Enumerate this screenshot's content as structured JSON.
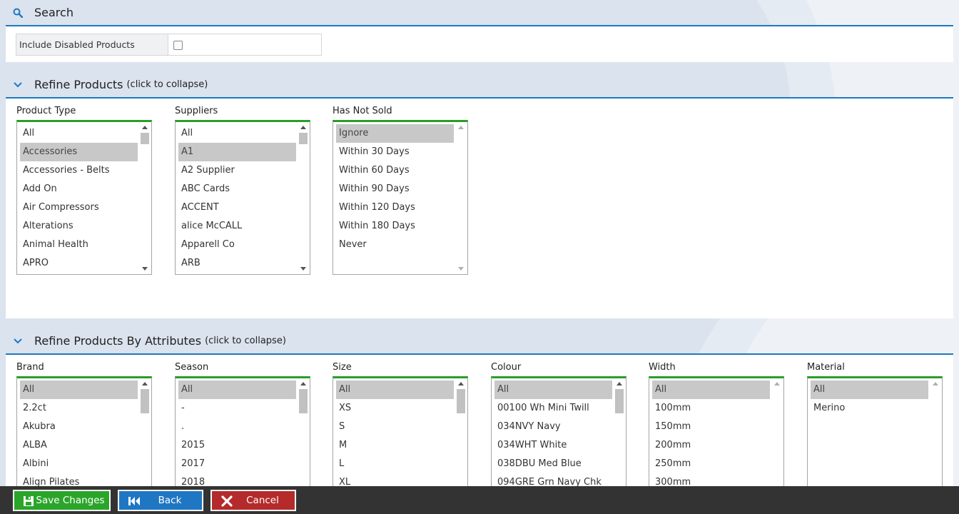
{
  "search": {
    "title": "Search"
  },
  "include_disabled": {
    "label": "Include Disabled Products",
    "checked": false
  },
  "refine_products": {
    "title": "Refine Products",
    "hint": "(click to collapse)",
    "lists": [
      {
        "label": "Product Type",
        "items": [
          "All",
          "Accessories",
          "Accessories - Belts",
          "Add On",
          "Air Compressors",
          "Alterations",
          "Animal Health",
          "APRO"
        ],
        "selected": 1,
        "scrollbar": true
      },
      {
        "label": "Suppliers",
        "items": [
          "All",
          "A1",
          "A2 Supplier",
          "ABC Cards",
          "ACCENT",
          "alice McCALL",
          "Apparell Co",
          "ARB"
        ],
        "selected": 1,
        "scrollbar": true
      },
      {
        "label": "Has Not Sold",
        "items": [
          "Ignore",
          "Within 30 Days",
          "Within 60 Days",
          "Within 90 Days",
          "Within 120 Days",
          "Within 180 Days",
          "Never"
        ],
        "selected": 0,
        "scrollbar": false
      }
    ]
  },
  "refine_attributes": {
    "title": "Refine Products By Attributes",
    "hint": "(click to collapse)",
    "lists": [
      {
        "label": "Brand",
        "items": [
          "All",
          "2.2ct",
          "Akubra",
          "ALBA",
          "Albini",
          "Align Pilates"
        ],
        "selected": 0,
        "scrollbar": true
      },
      {
        "label": "Season",
        "items": [
          "All",
          "-",
          ".",
          "2015",
          "2017",
          "2018"
        ],
        "selected": 0,
        "scrollbar": true
      },
      {
        "label": "Size",
        "items": [
          "All",
          "XS",
          "S",
          "M",
          "L",
          "XL"
        ],
        "selected": 0,
        "scrollbar": true
      },
      {
        "label": "Colour",
        "items": [
          "All",
          "00100 Wh Mini Twill",
          "034NVY Navy",
          "034WHT White",
          "038DBU Med Blue",
          "094GRE Grn Navy Chk"
        ],
        "selected": 0,
        "scrollbar": true
      },
      {
        "label": "Width",
        "items": [
          "All",
          "100mm",
          "150mm",
          "200mm",
          "250mm",
          "300mm"
        ],
        "selected": 0,
        "scrollbar": false
      },
      {
        "label": "Material",
        "items": [
          "All",
          "Merino"
        ],
        "selected": 0,
        "scrollbar": false
      }
    ]
  },
  "footer": {
    "save_label": "Save Changes",
    "back_label": "Back",
    "cancel_label": "Cancel"
  },
  "colors": {
    "accent_blue": "#1f78c1",
    "list_green": "#2a9d2a",
    "save_green": "#2aa52a",
    "back_blue": "#1f77c4",
    "cancel_red": "#b52b2b",
    "footer_bg": "#333333"
  },
  "icons": [
    "search-icon",
    "chevron-down-icon",
    "save-icon",
    "back-icon",
    "cancel-icon"
  ]
}
